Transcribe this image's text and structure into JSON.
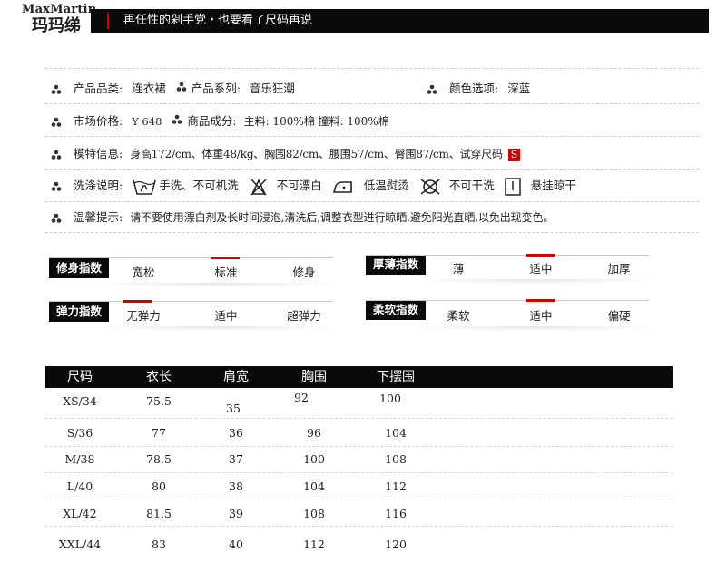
{
  "header": {
    "brand_en": "MaxMartin",
    "brand_cn": "玛玛绨",
    "slogan": "再任性的剁手党・也要看了尺码再说"
  },
  "info": {
    "category_label": "产品品类:",
    "category_value": "连衣裙",
    "series_label": "产品系列:",
    "series_value": "音乐狂潮",
    "color_label": "颜色选项:",
    "color_value": "深蓝",
    "price_label": "市场价格:",
    "price_value": "Y 648",
    "composition_label": "商品成分:",
    "composition_value": "主料: 100%棉 撞料: 100%棉",
    "model_label": "模特信息:",
    "model_value": "身高172/cm、体重48/kg、胸围82/cm、腰围57/cm、臀围87/cm、试穿尺码",
    "model_size": "S",
    "wash_label": "洗涤说明:",
    "wash_items": [
      "手洗、不可机洗",
      "不可漂白",
      "低温熨烫",
      "不可干洗",
      "悬挂晾干"
    ],
    "tips_label": "温馨提示:",
    "tips_value": "请不要使用漂白剂及长时间浸泡,清洗后,调整衣型进行晾晒,避免阳光直晒,以免出现变色。"
  },
  "indices": {
    "fit": {
      "label": "修身指数",
      "options": [
        "宽松",
        "标准",
        "修身"
      ],
      "selected": "标准"
    },
    "thickness": {
      "label": "厚薄指数",
      "options": [
        "薄",
        "适中",
        "加厚"
      ],
      "selected": "适中"
    },
    "stretch": {
      "label": "弹力指数",
      "options": [
        "无弹力",
        "适中",
        "超弹力"
      ],
      "selected": "无弹力"
    },
    "softness": {
      "label": "柔软指数",
      "options": [
        "柔软",
        "适中",
        "偏硬"
      ],
      "selected": "适中"
    }
  },
  "size_table": {
    "columns": [
      "尺码",
      "衣长",
      "肩宽",
      "胸围",
      "下摆围"
    ],
    "rows": [
      [
        "XS/34",
        "75.5",
        "35",
        "92",
        "100"
      ],
      [
        "S/36",
        "77",
        "36",
        "96",
        "104"
      ],
      [
        "M/38",
        "78.5",
        "37",
        "100",
        "108"
      ],
      [
        "L/40",
        "80",
        "38",
        "104",
        "112"
      ],
      [
        "XL/42",
        "81.5",
        "39",
        "108",
        "116"
      ],
      [
        "XXL/44",
        "83",
        "40",
        "112",
        "120"
      ]
    ]
  },
  "colors": {
    "accent": "#d40000",
    "bar": "#0a0a0a"
  }
}
